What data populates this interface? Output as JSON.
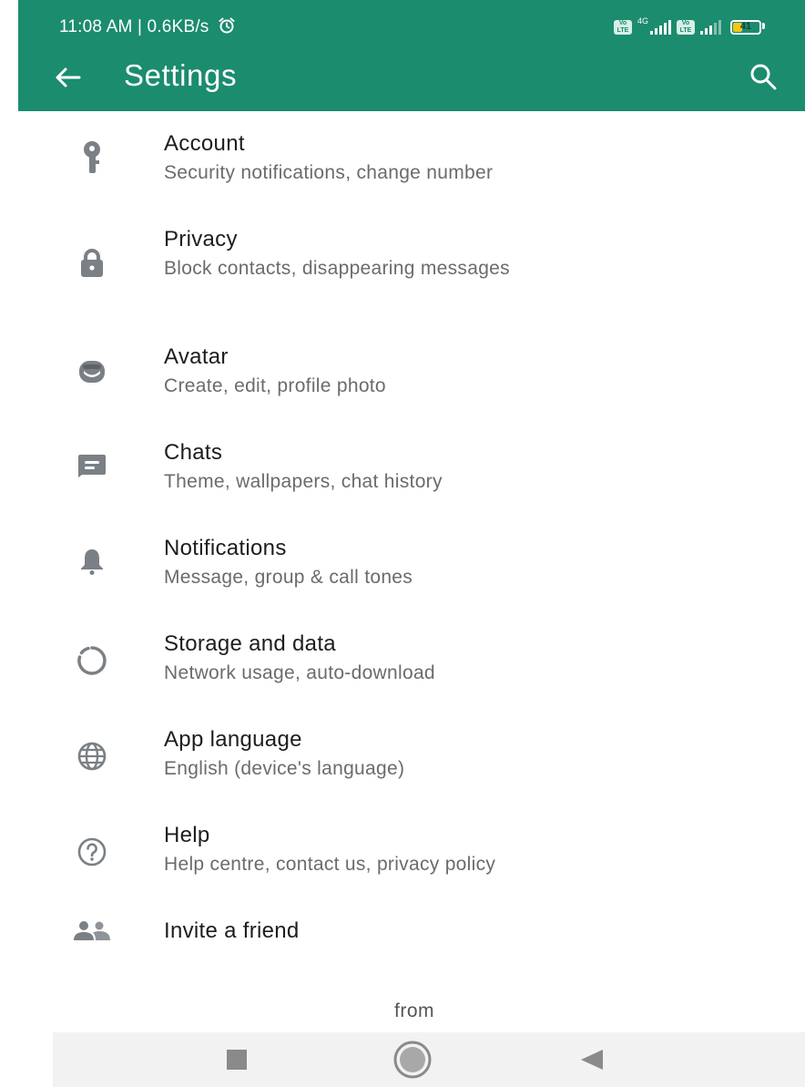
{
  "status_bar": {
    "time_speed": "11:08 AM | 0.6KB/s",
    "alarm_icon": "alarm-clock-icon",
    "sim1_badge": "Vo LTE",
    "network_type": "4G",
    "sim2_badge": "Vo LTE",
    "battery_level": "41",
    "battery_fraction": 0.41
  },
  "toolbar": {
    "back_icon": "arrow-left-icon",
    "title": "Settings",
    "search_icon": "search-icon"
  },
  "settings": {
    "items": [
      {
        "icon": "key-icon",
        "title": "Account",
        "subtitle": "Security notifications, change number"
      },
      {
        "icon": "lock-icon",
        "title": "Privacy",
        "subtitle": "Block contacts, disappearing messages"
      },
      {
        "icon": "avatar-icon",
        "title": "Avatar",
        "subtitle": "Create, edit, profile photo"
      },
      {
        "icon": "chat-icon",
        "title": "Chats",
        "subtitle": "Theme, wallpapers, chat history"
      },
      {
        "icon": "bell-icon",
        "title": "Notifications",
        "subtitle": "Message, group & call tones"
      },
      {
        "icon": "storage-circle-icon",
        "title": "Storage and data",
        "subtitle": "Network usage, auto-download"
      },
      {
        "icon": "globe-icon",
        "title": "App language",
        "subtitle": "English (device's language)"
      },
      {
        "icon": "help-icon",
        "title": "Help",
        "subtitle": "Help centre, contact us, privacy policy"
      },
      {
        "icon": "people-icon",
        "title": "Invite a friend"
      }
    ]
  },
  "footer": {
    "from_label": "from"
  },
  "nav_bar": {
    "recents_icon": "square-icon",
    "home_icon": "circle-home-icon",
    "back_icon": "triangle-back-icon"
  },
  "colors": {
    "header_bg": "#1b8c6e",
    "icon_gray": "#7a8085",
    "title_text": "#1d1d1d",
    "subtitle_text": "#6b6b6b",
    "battery_fill": "#f5c518"
  }
}
